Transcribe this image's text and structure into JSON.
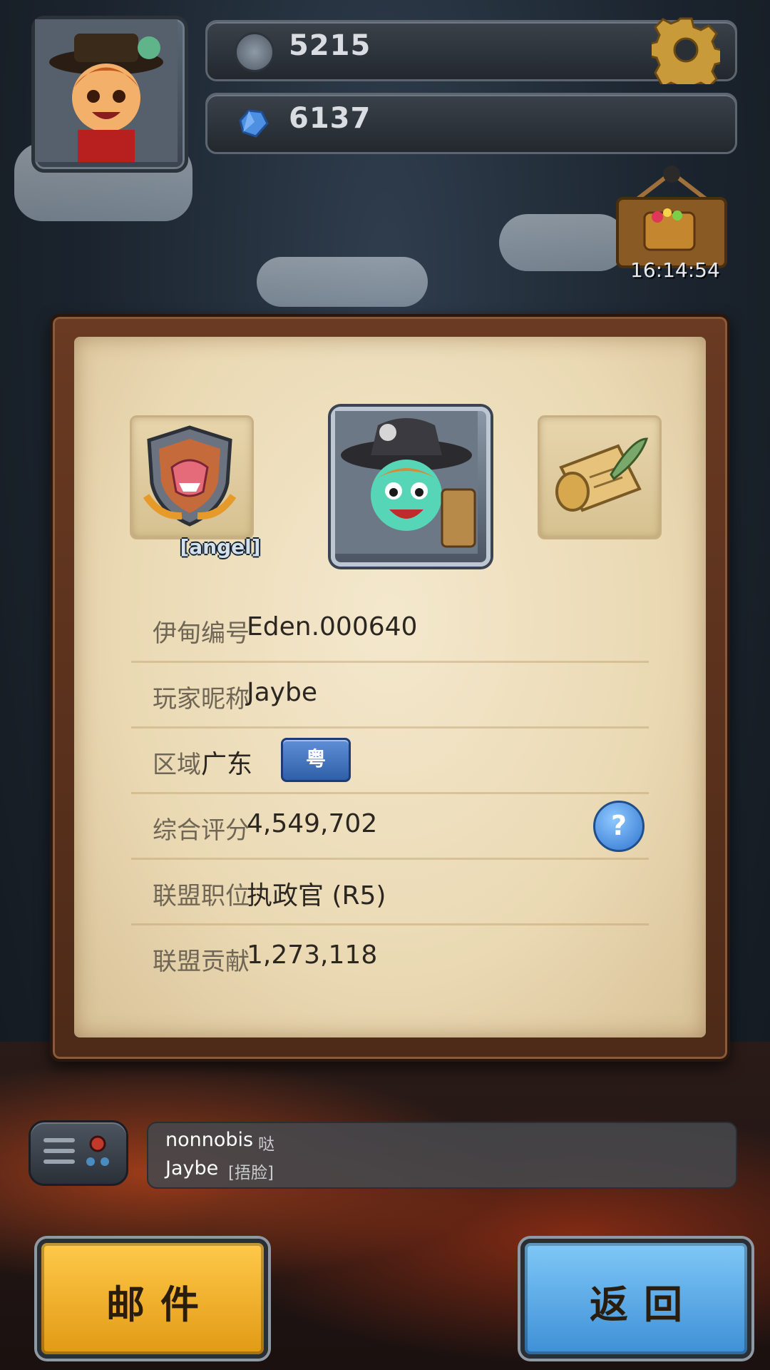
{
  "resources": {
    "coins": "5215",
    "gems": "6137"
  },
  "event_timer": "16:14:54",
  "profile": {
    "alliance_tag": "[angel]",
    "rows": [
      {
        "label": "伊甸编号",
        "value": "Eden.000640"
      },
      {
        "label": "玩家昵称",
        "value": "Jaybe"
      },
      {
        "label": "区域",
        "value": "广东"
      },
      {
        "label": "综合评分",
        "value": "4,549,702"
      },
      {
        "label": "联盟职位",
        "value": "执政官 (R5)"
      },
      {
        "label": "联盟贡献",
        "value": "1,273,118"
      }
    ],
    "region_badge": "粤",
    "help_symbol": "?"
  },
  "chat": {
    "lines": [
      {
        "name": "nonnobis",
        "msg": "哒"
      },
      {
        "name": "Jaybe",
        "msg": "[捂脸]"
      }
    ]
  },
  "buttons": {
    "mail": "邮件",
    "back": "返回"
  },
  "colors": {
    "mail_button": "#f2b42c",
    "back_button": "#5aa8e8",
    "parchment": "#efe1c0"
  },
  "icons": [
    "coin-icon",
    "gem-icon",
    "settings-gear-icon",
    "treasure-chest-icon",
    "alliance-emblem-icon",
    "scroll-quill-icon",
    "help-icon",
    "chat-menu-icon"
  ]
}
